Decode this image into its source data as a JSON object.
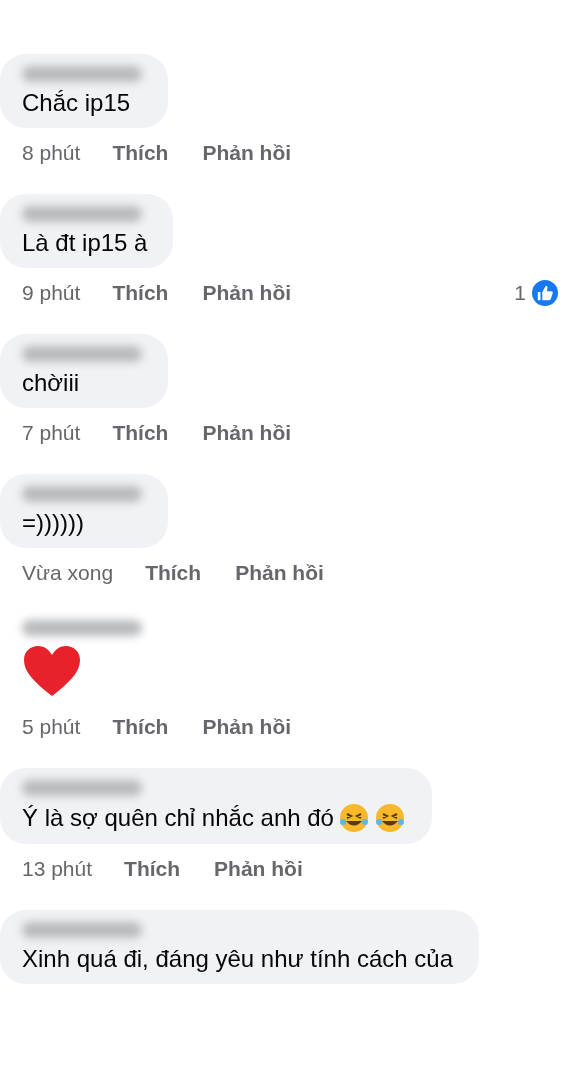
{
  "comments": [
    {
      "text": "Chắc ip15",
      "time": "8 phút",
      "like": "Thích",
      "reply": "Phản hồi"
    },
    {
      "text": "Là đt ip15 à",
      "time": "9 phút",
      "like": "Thích",
      "reply": "Phản hồi",
      "reaction_count": "1"
    },
    {
      "text": "chờiii",
      "time": "7 phút",
      "like": "Thích",
      "reply": "Phản hồi"
    },
    {
      "text": "=))))))",
      "time": "Vừa xong",
      "like": "Thích",
      "reply": "Phản hồi"
    },
    {
      "emojis": [
        {
          "kind": "heart"
        }
      ],
      "time": "5 phút",
      "like": "Thích",
      "reply": "Phản hồi"
    },
    {
      "text": "Ý là sợ quên chỉ nhắc anh đó",
      "emojis": [
        {
          "kind": "laugh"
        },
        {
          "kind": "laugh"
        }
      ],
      "time": "13 phút",
      "like": "Thích",
      "reply": "Phản hồi"
    },
    {
      "text": "Xinh quá đi, đáng yêu như tính cách của"
    }
  ]
}
